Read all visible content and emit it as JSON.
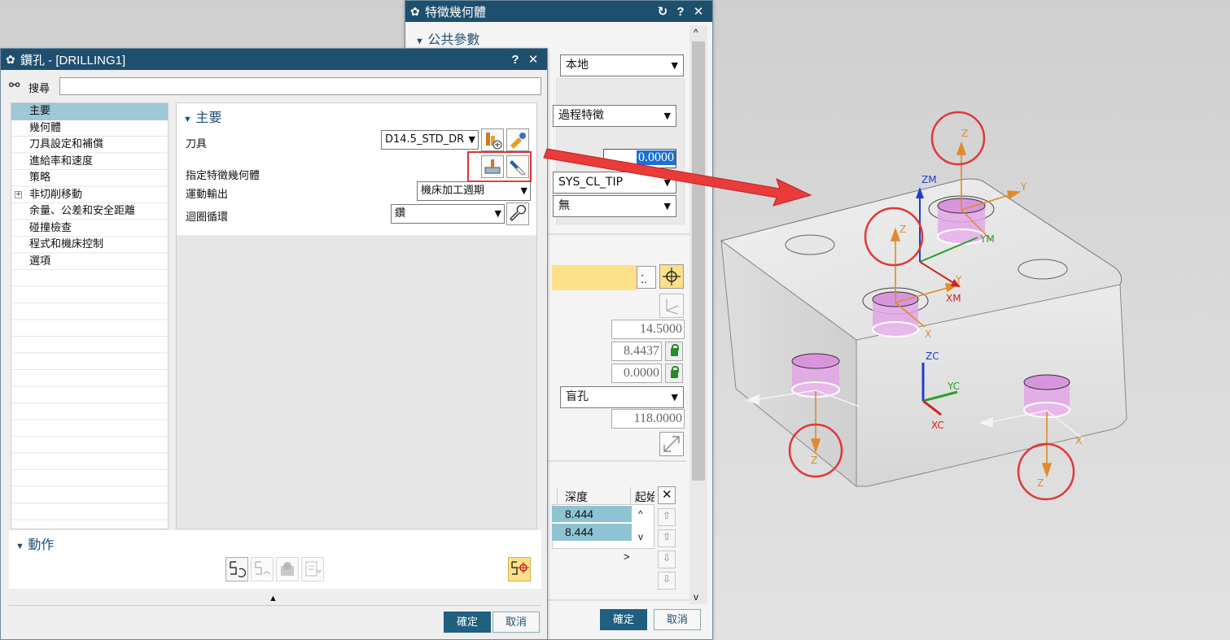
{
  "feature_dialog": {
    "title": "特徵幾何體",
    "section_common": "公共參數",
    "coord_mode": "本地",
    "source": "過程特徵",
    "value_field": "0.0000",
    "reference_point": "SYS_CL_TIP",
    "option": "無",
    "diameter": "14.5000",
    "depth_1": "8.4437",
    "depth_2": "0.0000",
    "hole_type": "盲孔",
    "angle": "118.0000",
    "table": {
      "columns": [
        "深度",
        "起始"
      ],
      "rows": [
        [
          "8.444"
        ],
        [
          "8.444"
        ]
      ]
    },
    "ok_label": "確定",
    "cancel_label": "取消"
  },
  "drilling_dialog": {
    "title": "鑽孔 - [DRILLING1]",
    "search_label": "搜尋",
    "tree": [
      {
        "label": "主要",
        "selected": true,
        "expand": false
      },
      {
        "label": "幾何體",
        "selected": false,
        "expand": false
      },
      {
        "label": "刀具設定和補償",
        "selected": false,
        "expand": false
      },
      {
        "label": "進給率和速度",
        "selected": false,
        "expand": false
      },
      {
        "label": "策略",
        "selected": false,
        "expand": false
      },
      {
        "label": "非切削移動",
        "selected": false,
        "expand": true
      },
      {
        "label": "余量、公差和安全距離",
        "selected": false,
        "expand": false
      },
      {
        "label": "碰撞檢查",
        "selected": false,
        "expand": false
      },
      {
        "label": "程式和機床控制",
        "selected": false,
        "expand": false
      },
      {
        "label": "選項",
        "selected": false,
        "expand": false
      }
    ],
    "main_section": "主要",
    "tool_label": "刀具",
    "tool_value": "D14.5_STD_DR",
    "feature_geom_label": "指定特徵幾何體",
    "motion_output_label": "運動輸出",
    "motion_output_value": "機床加工週期",
    "cycle_label": "迴圈循環",
    "cycle_value": "鑽",
    "actions_label": "動作",
    "ok_label": "確定",
    "cancel_label": "取消"
  },
  "view3d": {
    "axis_labels": {
      "z": "Z",
      "x": "X",
      "y": "Y",
      "zm": "ZM",
      "xm": "XM",
      "ym": "YM",
      "zc": "ZC",
      "xc": "XC",
      "yc": "YC"
    }
  },
  "colors": {
    "titlebar": "#1f4f6f",
    "highlight_red": "#e03030",
    "selection": "#9ec7d8",
    "yellow_field": "#fde08a",
    "hole_pink": "#e2a5e6",
    "axis_orange": "#e08a2a"
  }
}
